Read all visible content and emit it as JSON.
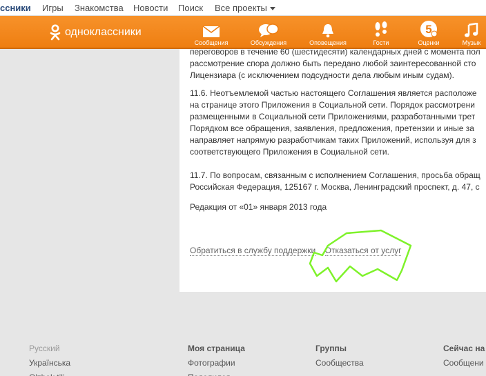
{
  "topnav": {
    "brand": "ссники",
    "links": [
      "Игры",
      "Знакомства",
      "Новости",
      "Поиск",
      "Все проекты"
    ]
  },
  "header": {
    "logo_text": "одноклассники",
    "nav": [
      {
        "label": "Сообщения",
        "icon": "envelope-icon"
      },
      {
        "label": "Обсуждения",
        "icon": "chat-bubbles-icon"
      },
      {
        "label": "Оповещения",
        "icon": "bell-icon"
      },
      {
        "label": "Гости",
        "icon": "footprints-icon"
      },
      {
        "label": "Оценки",
        "icon": "rating-five-icon"
      },
      {
        "label": "Музык",
        "icon": "music-note-icon"
      }
    ],
    "colors": {
      "bar": "#f7922a",
      "bar_dark": "#ee7d10"
    }
  },
  "content": {
    "lines": [
      "переговоров в течение 60 (шестидесяти) календарных дней с момента пол",
      "рассмотрение спора должно быть передано любой заинтересованной сто",
      "Лицензиара (с исключением подсудности дела любым иным судам).",
      "11.6. Неотъемлемой частью настоящего Соглашения является расположе",
      "на странице этого Приложения в Социальной сети. Порядок рассмотрени",
      "размещенными в Социальной сети Приложениями, разработанными трет",
      "Порядком все обращения, заявления, предложения, претензии и иные за",
      "направляет напрямую разработчикам таких Приложений, используя для з",
      "соответствующего Приложения в Социальной сети.",
      "11.7. По вопросам, связанным с исполнением Соглашения, просьба обращ",
      "Российская Федерация, 125167 г. Москва, Ленинградский проспект, д. 47, с",
      "Редакция от «01» января 2013 года"
    ],
    "support_link": "Обратиться в службу поддержки",
    "cancel_link": "Отказаться от услуг",
    "highlight_color": "#7ef22a"
  },
  "footer": {
    "languages": [
      "Русский",
      "Українська",
      "O'zbek tili"
    ],
    "my_page": {
      "title": "Моя страница",
      "items": [
        "Фотографии",
        "Поделился"
      ]
    },
    "groups": {
      "title": "Группы",
      "items": [
        "Сообщества"
      ]
    },
    "now_on": {
      "title": "Сейчас на",
      "items": [
        "Сообщени"
      ]
    }
  }
}
